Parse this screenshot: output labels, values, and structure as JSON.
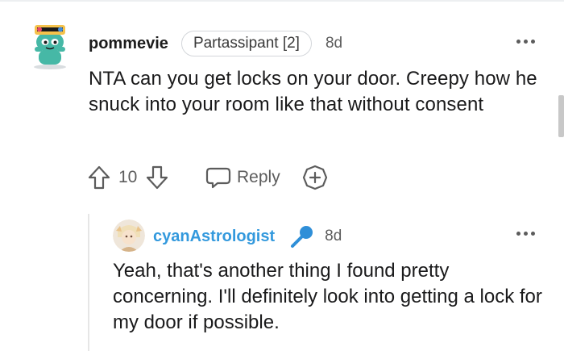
{
  "comment": {
    "author": "pommevie",
    "flair": "Partassipant [2]",
    "age": "8d",
    "body": "NTA can you get locks on your door. Creepy how he snuck into your room like that without consent",
    "avatar_icon": "snoo-avatar-icon",
    "actions": {
      "score": "10",
      "reply_label": "Reply",
      "upvote_icon": "upvote-arrow-icon",
      "downvote_icon": "downvote-arrow-icon",
      "reply_icon": "chat-bubble-icon",
      "award_icon": "award-plus-icon"
    },
    "more_icon": "more-dots-icon"
  },
  "reply": {
    "author": "cyanAstrologist",
    "author_color": "#3399dd",
    "badge_icon": "microphone-icon",
    "age": "8d",
    "body": "Yeah, that's another thing I found pretty concerning. I'll definitely look into getting a lock for my door if possible.",
    "avatar_icon": "user-avatar-icon",
    "more_icon": "more-dots-icon"
  }
}
